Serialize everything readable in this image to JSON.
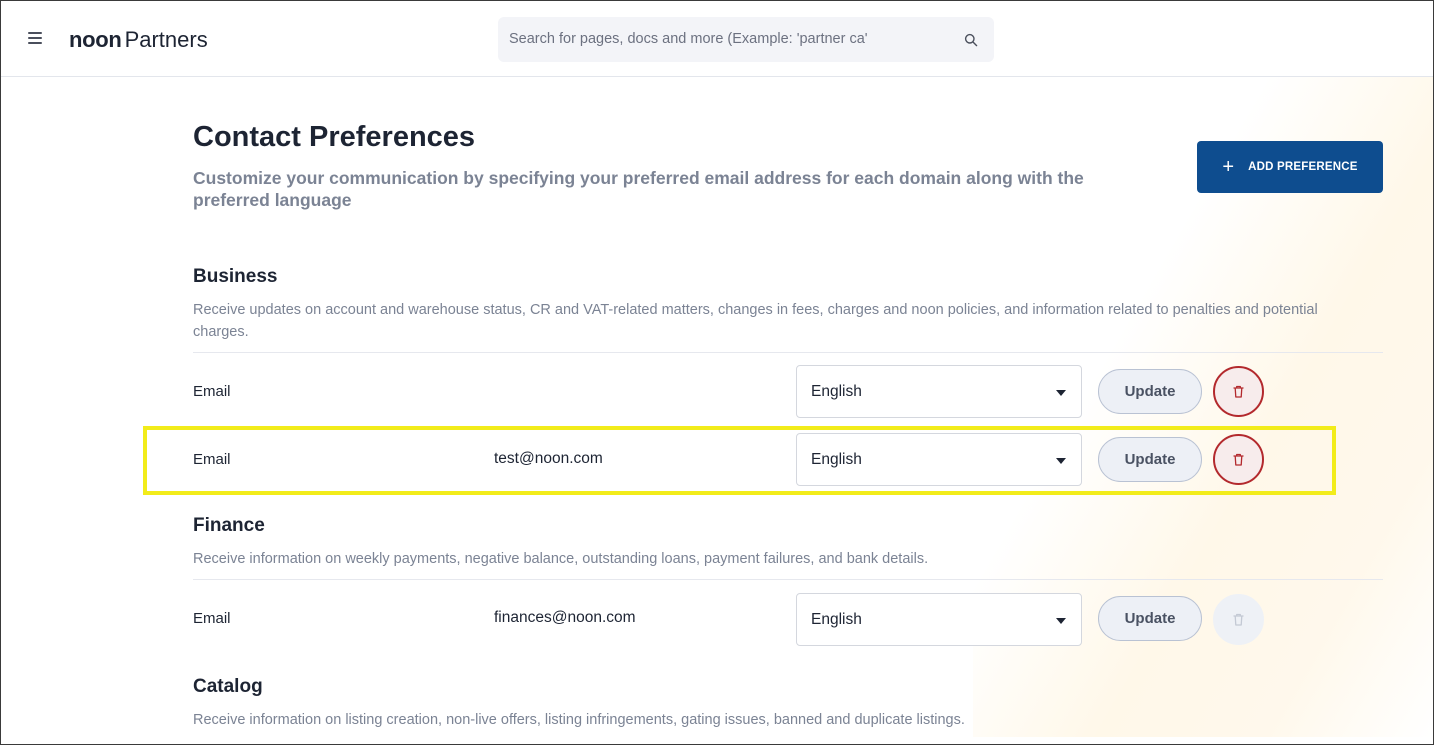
{
  "header": {
    "brand_bold": "noon",
    "brand_light": "Partners",
    "search_placeholder": "Search for pages, docs and more (Example: 'partner ca'"
  },
  "page": {
    "title": "Contact Preferences",
    "subtitle": "Customize your communication by specifying your preferred email address for each domain along with the preferred language",
    "add_button_label": "ADD PREFERENCE",
    "add_button_icon": "plus-icon"
  },
  "sections": [
    {
      "title": "Business",
      "description": "Receive updates on account and warehouse status, CR and VAT-related matters, changes in fees, charges and noon policies, and information related to penalties and potential charges.",
      "rows": [
        {
          "label": "Email",
          "email": "",
          "language": "English",
          "update_label": "Update",
          "delete_icon": "trash-icon",
          "delete_enabled": true
        },
        {
          "label": "Email",
          "email": "test@noon.com",
          "language": "English",
          "update_label": "Update",
          "delete_icon": "trash-icon",
          "delete_enabled": true,
          "highlighted": true
        }
      ]
    },
    {
      "title": "Finance",
      "description": "Receive information on weekly payments, negative balance, outstanding loans, payment failures, and bank details.",
      "rows": [
        {
          "label": "Email",
          "email": "finances@noon.com",
          "language": "English",
          "update_label": "Update",
          "delete_icon": "trash-icon",
          "delete_enabled": false
        }
      ]
    },
    {
      "title": "Catalog",
      "description": "Receive information on listing creation, non-live offers, listing infringements, gating issues, banned and duplicate listings."
    }
  ],
  "colors": {
    "primary": "#0e4d8f",
    "danger": "#b3292d",
    "highlight": "#f2ec1a",
    "muted_text": "#7b8394"
  }
}
